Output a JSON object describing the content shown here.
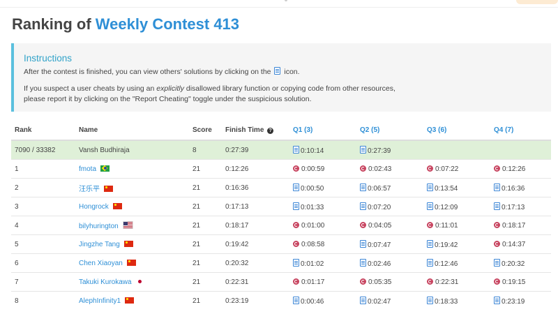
{
  "page": {
    "title_prefix": "Ranking of ",
    "contest_name": "Weekly Contest 413"
  },
  "instructions": {
    "title": "Instructions",
    "line1_before": "After the contest is finished, you can view others' solutions by clicking on the",
    "line1_after": "icon.",
    "line2_a": "If you suspect a user cheats by using an ",
    "line2_em": "explicitly",
    "line2_b": " disallowed library function or copying code from other resources,",
    "line3": "please report it by clicking on the \"Report Cheating\" toggle under the suspicious solution."
  },
  "table": {
    "headers": {
      "rank": "Rank",
      "name": "Name",
      "score": "Score",
      "finish_time": "Finish Time",
      "q1": "Q1 (3)",
      "q2": "Q2 (5)",
      "q3": "Q3 (6)",
      "q4": "Q4 (7)"
    },
    "rows": [
      {
        "rank": "7090 / 33382",
        "name": "Vansh Budhiraja",
        "flag": "",
        "score": "8",
        "finish": "0:27:39",
        "me": true,
        "q": [
          {
            "t": "0:10:14",
            "lang": "file"
          },
          {
            "t": "0:27:39",
            "lang": "file"
          },
          {
            "t": "",
            "lang": ""
          },
          {
            "t": "",
            "lang": ""
          }
        ]
      },
      {
        "rank": "1",
        "name": "fmota",
        "flag": "br",
        "score": "21",
        "finish": "0:12:26",
        "q": [
          {
            "t": "0:00:59",
            "lang": "cpp"
          },
          {
            "t": "0:02:43",
            "lang": "cpp"
          },
          {
            "t": "0:07:22",
            "lang": "cpp"
          },
          {
            "t": "0:12:26",
            "lang": "cpp"
          }
        ]
      },
      {
        "rank": "2",
        "name": "汪乐平",
        "flag": "cn",
        "score": "21",
        "finish": "0:16:36",
        "q": [
          {
            "t": "0:00:50",
            "lang": "file"
          },
          {
            "t": "0:06:57",
            "lang": "file"
          },
          {
            "t": "0:13:54",
            "lang": "file"
          },
          {
            "t": "0:16:36",
            "lang": "file"
          }
        ]
      },
      {
        "rank": "3",
        "name": "Hongrock",
        "flag": "cn",
        "score": "21",
        "finish": "0:17:13",
        "q": [
          {
            "t": "0:01:33",
            "lang": "file"
          },
          {
            "t": "0:07:20",
            "lang": "file"
          },
          {
            "t": "0:12:09",
            "lang": "file"
          },
          {
            "t": "0:17:13",
            "lang": "file"
          }
        ]
      },
      {
        "rank": "4",
        "name": "bilyhurington",
        "flag": "us",
        "score": "21",
        "finish": "0:18:17",
        "q": [
          {
            "t": "0:01:00",
            "lang": "cpp"
          },
          {
            "t": "0:04:05",
            "lang": "cpp"
          },
          {
            "t": "0:11:01",
            "lang": "cpp"
          },
          {
            "t": "0:18:17",
            "lang": "cpp"
          }
        ]
      },
      {
        "rank": "5",
        "name": "Jingzhe Tang",
        "flag": "cn",
        "score": "21",
        "finish": "0:19:42",
        "q": [
          {
            "t": "0:08:58",
            "lang": "cpp"
          },
          {
            "t": "0:07:47",
            "lang": "file"
          },
          {
            "t": "0:19:42",
            "lang": "file"
          },
          {
            "t": "0:14:37",
            "lang": "cpp"
          }
        ]
      },
      {
        "rank": "6",
        "name": "Chen Xiaoyan",
        "flag": "cn",
        "score": "21",
        "finish": "0:20:32",
        "q": [
          {
            "t": "0:01:02",
            "lang": "file"
          },
          {
            "t": "0:02:46",
            "lang": "file"
          },
          {
            "t": "0:12:46",
            "lang": "file"
          },
          {
            "t": "0:20:32",
            "lang": "file"
          }
        ]
      },
      {
        "rank": "7",
        "name": "Takuki Kurokawa",
        "flag": "jp",
        "score": "21",
        "finish": "0:22:31",
        "q": [
          {
            "t": "0:01:17",
            "lang": "cpp"
          },
          {
            "t": "0:05:35",
            "lang": "cpp"
          },
          {
            "t": "0:22:31",
            "lang": "cpp"
          },
          {
            "t": "0:19:15",
            "lang": "cpp"
          }
        ]
      },
      {
        "rank": "8",
        "name": "AlephInfinity1",
        "flag": "cn",
        "score": "21",
        "finish": "0:23:19",
        "q": [
          {
            "t": "0:00:46",
            "lang": "file"
          },
          {
            "t": "0:02:47",
            "lang": "file"
          },
          {
            "t": "0:18:33",
            "lang": "file"
          },
          {
            "t": "0:23:19",
            "lang": "file"
          }
        ]
      }
    ]
  },
  "icons": {
    "solution": "file-code-icon",
    "cpp": "cpp-language-icon",
    "help": "question-circle-icon"
  },
  "colors": {
    "accent": "#2e8fd6",
    "info": "#5bc0de",
    "my_row": "#dff0d8"
  }
}
